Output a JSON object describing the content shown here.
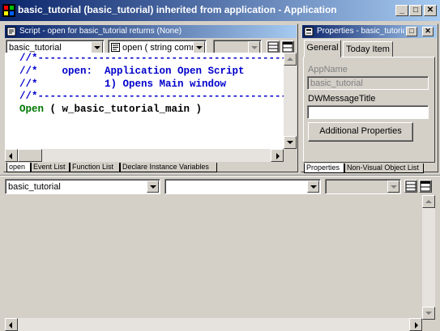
{
  "main_window": {
    "title": "basic_tutorial (basic_tutorial) inherited from application - Application",
    "min_label": "_",
    "max_label": "□",
    "close_label": "✕"
  },
  "script_window": {
    "title": "Script - open for basic_tutorial returns (None)",
    "object_combo": "basic_tutorial",
    "event_combo": "open ( string comn",
    "code_lines": [
      {
        "text": "//*-----------------------------------------",
        "kind": "comment"
      },
      {
        "text": "//*    open:  Application Open Script",
        "kind": "comment"
      },
      {
        "text": "//*           1) Opens Main window",
        "kind": "comment"
      },
      {
        "text": "//*-----------------------------------------",
        "kind": "comment"
      }
    ],
    "code_keyword": "Open",
    "code_rest": " ( w_basic_tutorial_main )",
    "bottom_tabs": [
      "open",
      "Event List",
      "Function List",
      "Declare Instance Variables"
    ]
  },
  "properties_window": {
    "title": "Properties - basic_tutorial",
    "tabs": [
      "General",
      "Today Item"
    ],
    "appname_label": "AppName",
    "appname_value": "basic_tutorial",
    "dwmessage_label": "DWMessageTitle",
    "dwmessage_value": "",
    "additional_button": "Additional Properties",
    "bottom_tabs": [
      "Properties",
      "Non-Visual Object List"
    ]
  },
  "lower_pane": {
    "object_combo": "basic_tutorial",
    "event_combo": ""
  }
}
